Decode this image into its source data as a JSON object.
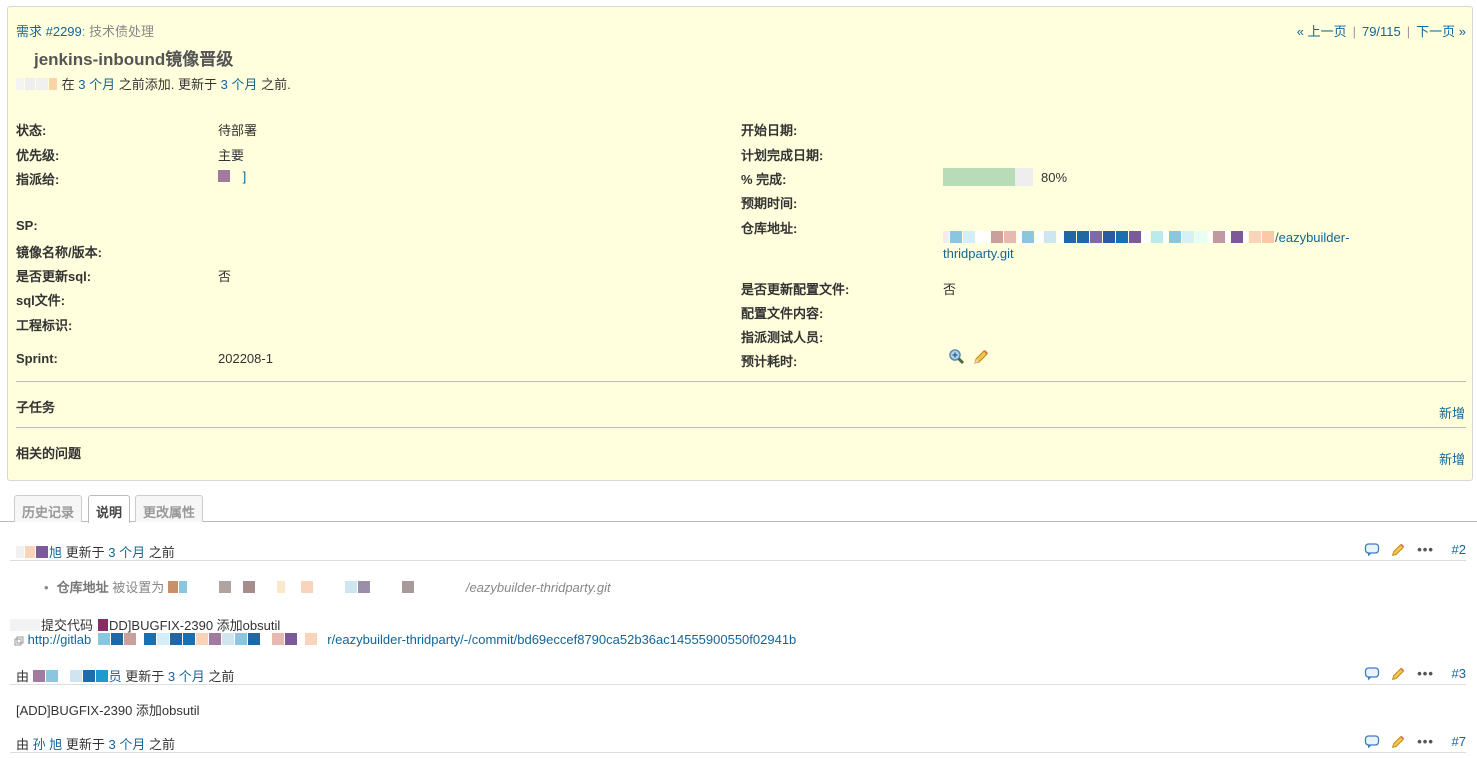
{
  "header": {
    "tracker_link": "需求 #2299",
    "category": "技术债处理",
    "prev": "« 上一页",
    "position": "79/115",
    "next": "下一页 »",
    "subject": "jenkins-inbound镜像晋级",
    "author_in": "在",
    "created_ago": "3 个月",
    "added_text": "之前添加. 更新于",
    "updated_ago": "3 个月",
    "before_text": "之前."
  },
  "attributes_left": [
    {
      "label": "状态:",
      "value": "待部署"
    },
    {
      "label": "优先级:",
      "value": "主要"
    },
    {
      "label": "指派给:",
      "value": "]"
    },
    {
      "label": "SP:",
      "value": ""
    },
    {
      "label": "镜像名称/版本:",
      "value": ""
    },
    {
      "label": "是否更新sql:",
      "value": "否"
    },
    {
      "label": "sql文件:",
      "value": ""
    },
    {
      "label": "工程标识:",
      "value": ""
    },
    {
      "label": "Sprint:",
      "value": "202208-1"
    }
  ],
  "attributes_right": [
    {
      "label": "开始日期:",
      "value": ""
    },
    {
      "label": "计划完成日期:",
      "value": ""
    },
    {
      "label": "% 完成:",
      "value": "80%"
    },
    {
      "label": "预期时间:",
      "value": ""
    },
    {
      "label": "仓库地址:",
      "value_line1": "/eazybuilder-",
      "value_line2": "thridparty.git"
    },
    {
      "label": "是否更新配置文件:",
      "value": "否"
    },
    {
      "label": "配置文件内容:",
      "value": ""
    },
    {
      "label": "指派测试人员:",
      "value": ""
    },
    {
      "label": "预计耗时:",
      "value": ""
    }
  ],
  "progress": {
    "percent": 80,
    "label": "80%",
    "fill_color": "#b8dcb8"
  },
  "subtasks": {
    "title": "子任务",
    "add": "新增"
  },
  "relations": {
    "title": "相关的问题",
    "add": "新增"
  },
  "tabs": [
    {
      "label": "历史记录",
      "active": false
    },
    {
      "label": "说明",
      "active": true
    },
    {
      "label": "更改属性",
      "active": false
    }
  ],
  "journals": [
    {
      "by_suffix": "旭",
      "updated": "更新于",
      "ago": "3 个月",
      "before": "之前",
      "number": "#2",
      "detail_label": "仓库地址",
      "detail_text": "被设置为",
      "detail_value": "/eazybuilder-thridparty.git",
      "commit_prefix": "提交代码",
      "commit_msg": "DD]BUGFIX-2390 添加obsutil",
      "commit_url_head": "http://gitlab",
      "commit_url_tail": "r/eazybuilder-thridparty/-/commit/bd69eccef8790ca52b36ac14555900550f02941b"
    },
    {
      "by": "由",
      "by_suffix": "员",
      "updated": "更新于",
      "ago": "3 个月",
      "before": "之前",
      "number": "#3",
      "note": "[ADD]BUGFIX-2390 添加obsutil"
    },
    {
      "by": "由",
      "user": "孙 旭",
      "updated": "更新于",
      "ago": "3 个月",
      "before": "之前",
      "number": "#7"
    }
  ],
  "icons": [
    "zoom-in-icon",
    "edit-pencil-icon",
    "comment-icon",
    "more-icon",
    "link-icon"
  ]
}
